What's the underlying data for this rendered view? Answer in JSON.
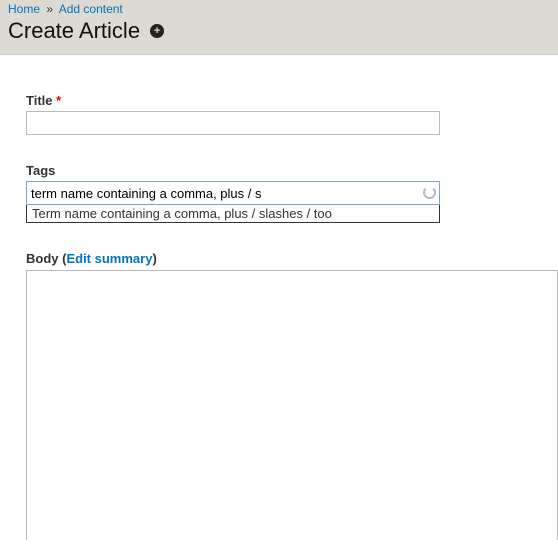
{
  "breadcrumb": {
    "home": "Home",
    "add_content": "Add content"
  },
  "page_title": "Create Article",
  "title_section": {
    "label": "Title",
    "required": "*",
    "value": ""
  },
  "tags_section": {
    "label": "Tags",
    "value": "term name containing a comma, plus / s",
    "suggestion": "Term name containing a comma, plus / slashes / too"
  },
  "body_section": {
    "label": "Body",
    "edit_summary": "Edit summary",
    "value": ""
  }
}
